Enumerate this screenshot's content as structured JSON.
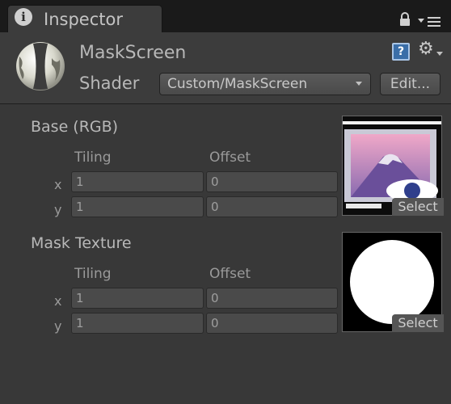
{
  "tab": {
    "title": "Inspector",
    "info_icon": "i"
  },
  "material": {
    "name": "MaskScreen"
  },
  "shader": {
    "label": "Shader",
    "value": "Custom/MaskScreen",
    "edit_label": "Edit..."
  },
  "header_icons": {
    "help": "?",
    "gear": "⚙"
  },
  "properties": [
    {
      "name": "Base (RGB)",
      "tiling_label": "Tiling",
      "offset_label": "Offset",
      "x_label": "x",
      "y_label": "y",
      "tiling": {
        "x": "1",
        "y": "1"
      },
      "offset": {
        "x": "0",
        "y": "0"
      },
      "select_label": "Select"
    },
    {
      "name": "Mask Texture",
      "tiling_label": "Tiling",
      "offset_label": "Offset",
      "x_label": "x",
      "y_label": "y",
      "tiling": {
        "x": "1",
        "y": "1"
      },
      "offset": {
        "x": "0",
        "y": "0"
      },
      "select_label": "Select"
    }
  ],
  "colors": {
    "background": "#383838",
    "header_background": "#3c3c3c",
    "tab_strip": "#1a1a1a",
    "field": "#4a4a4a",
    "help_icon": "#3a6ea8"
  }
}
